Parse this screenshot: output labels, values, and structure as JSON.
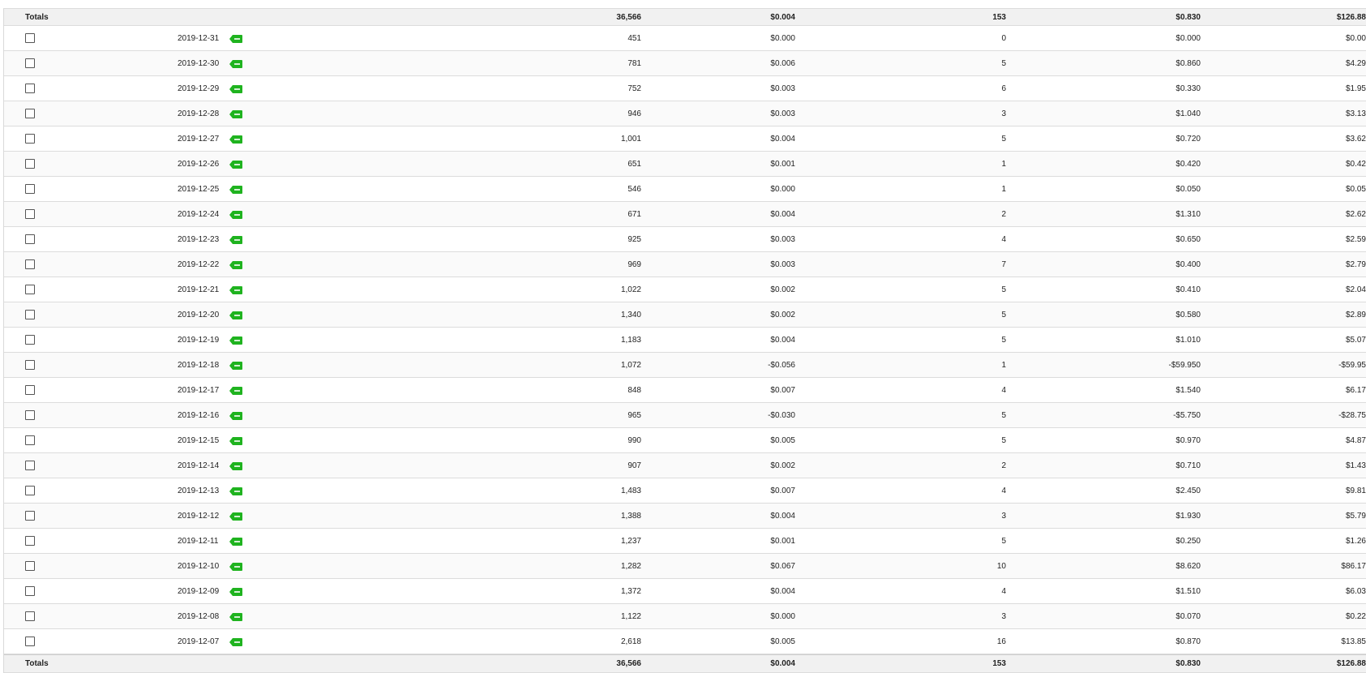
{
  "colors": {
    "tag_green": "#1fb31f",
    "totals_bg": "#f1f1f1",
    "border": "#dcdcdc"
  },
  "icons": {
    "row_tag": "green-tag-icon",
    "row_select": "checkbox"
  },
  "totals_top": {
    "label": "Totals",
    "c1": "36,566",
    "c2": "$0.004",
    "c3": "153",
    "c4": "$0.830",
    "c5": "$126.88"
  },
  "rows": [
    {
      "date": "2019-12-31",
      "c1": "451",
      "c2": "$0.000",
      "c3": "0",
      "c4": "$0.000",
      "c5": "$0.00"
    },
    {
      "date": "2019-12-30",
      "c1": "781",
      "c2": "$0.006",
      "c3": "5",
      "c4": "$0.860",
      "c5": "$4.29"
    },
    {
      "date": "2019-12-29",
      "c1": "752",
      "c2": "$0.003",
      "c3": "6",
      "c4": "$0.330",
      "c5": "$1.95"
    },
    {
      "date": "2019-12-28",
      "c1": "946",
      "c2": "$0.003",
      "c3": "3",
      "c4": "$1.040",
      "c5": "$3.13"
    },
    {
      "date": "2019-12-27",
      "c1": "1,001",
      "c2": "$0.004",
      "c3": "5",
      "c4": "$0.720",
      "c5": "$3.62"
    },
    {
      "date": "2019-12-26",
      "c1": "651",
      "c2": "$0.001",
      "c3": "1",
      "c4": "$0.420",
      "c5": "$0.42"
    },
    {
      "date": "2019-12-25",
      "c1": "546",
      "c2": "$0.000",
      "c3": "1",
      "c4": "$0.050",
      "c5": "$0.05"
    },
    {
      "date": "2019-12-24",
      "c1": "671",
      "c2": "$0.004",
      "c3": "2",
      "c4": "$1.310",
      "c5": "$2.62"
    },
    {
      "date": "2019-12-23",
      "c1": "925",
      "c2": "$0.003",
      "c3": "4",
      "c4": "$0.650",
      "c5": "$2.59"
    },
    {
      "date": "2019-12-22",
      "c1": "969",
      "c2": "$0.003",
      "c3": "7",
      "c4": "$0.400",
      "c5": "$2.79"
    },
    {
      "date": "2019-12-21",
      "c1": "1,022",
      "c2": "$0.002",
      "c3": "5",
      "c4": "$0.410",
      "c5": "$2.04"
    },
    {
      "date": "2019-12-20",
      "c1": "1,340",
      "c2": "$0.002",
      "c3": "5",
      "c4": "$0.580",
      "c5": "$2.89"
    },
    {
      "date": "2019-12-19",
      "c1": "1,183",
      "c2": "$0.004",
      "c3": "5",
      "c4": "$1.010",
      "c5": "$5.07"
    },
    {
      "date": "2019-12-18",
      "c1": "1,072",
      "c2": "-$0.056",
      "c3": "1",
      "c4": "-$59.950",
      "c5": "-$59.95"
    },
    {
      "date": "2019-12-17",
      "c1": "848",
      "c2": "$0.007",
      "c3": "4",
      "c4": "$1.540",
      "c5": "$6.17"
    },
    {
      "date": "2019-12-16",
      "c1": "965",
      "c2": "-$0.030",
      "c3": "5",
      "c4": "-$5.750",
      "c5": "-$28.75"
    },
    {
      "date": "2019-12-15",
      "c1": "990",
      "c2": "$0.005",
      "c3": "5",
      "c4": "$0.970",
      "c5": "$4.87"
    },
    {
      "date": "2019-12-14",
      "c1": "907",
      "c2": "$0.002",
      "c3": "2",
      "c4": "$0.710",
      "c5": "$1.43"
    },
    {
      "date": "2019-12-13",
      "c1": "1,483",
      "c2": "$0.007",
      "c3": "4",
      "c4": "$2.450",
      "c5": "$9.81"
    },
    {
      "date": "2019-12-12",
      "c1": "1,388",
      "c2": "$0.004",
      "c3": "3",
      "c4": "$1.930",
      "c5": "$5.79"
    },
    {
      "date": "2019-12-11",
      "c1": "1,237",
      "c2": "$0.001",
      "c3": "5",
      "c4": "$0.250",
      "c5": "$1.26"
    },
    {
      "date": "2019-12-10",
      "c1": "1,282",
      "c2": "$0.067",
      "c3": "10",
      "c4": "$8.620",
      "c5": "$86.17"
    },
    {
      "date": "2019-12-09",
      "c1": "1,372",
      "c2": "$0.004",
      "c3": "4",
      "c4": "$1.510",
      "c5": "$6.03"
    },
    {
      "date": "2019-12-08",
      "c1": "1,122",
      "c2": "$0.000",
      "c3": "3",
      "c4": "$0.070",
      "c5": "$0.22"
    },
    {
      "date": "2019-12-07",
      "c1": "2,618",
      "c2": "$0.005",
      "c3": "16",
      "c4": "$0.870",
      "c5": "$13.85"
    }
  ],
  "totals_bottom": {
    "label": "Totals",
    "c1": "36,566",
    "c2": "$0.004",
    "c3": "153",
    "c4": "$0.830",
    "c5": "$126.88"
  }
}
